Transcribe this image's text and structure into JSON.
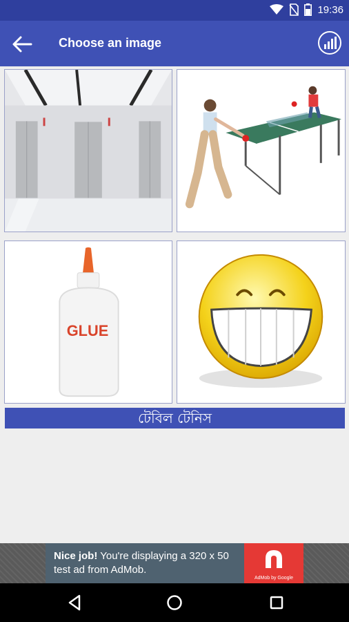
{
  "status_bar": {
    "time": "19:36",
    "icons": [
      "wifi-icon",
      "no-sim-icon",
      "battery-icon"
    ]
  },
  "app_bar": {
    "title": "Choose an image",
    "back_icon": "arrow-back-icon",
    "action_icon": "stats-chart-icon"
  },
  "images": [
    {
      "subject": "elevators"
    },
    {
      "subject": "table-tennis"
    },
    {
      "subject": "glue"
    },
    {
      "subject": "smiley"
    }
  ],
  "glue_bottle_label": "GLUE",
  "answer_word": "টেবিল টেনিস",
  "ad": {
    "headline": "Nice job!",
    "body": " You're displaying a 320 x 50 test ad from AdMob.",
    "logo_caption": "AdMob by Google"
  },
  "nav": [
    "back-icon",
    "home-icon",
    "recents-icon"
  ],
  "colors": {
    "primary": "#3f51b5",
    "status": "#2f3f9e",
    "ad_red": "#e53935"
  }
}
